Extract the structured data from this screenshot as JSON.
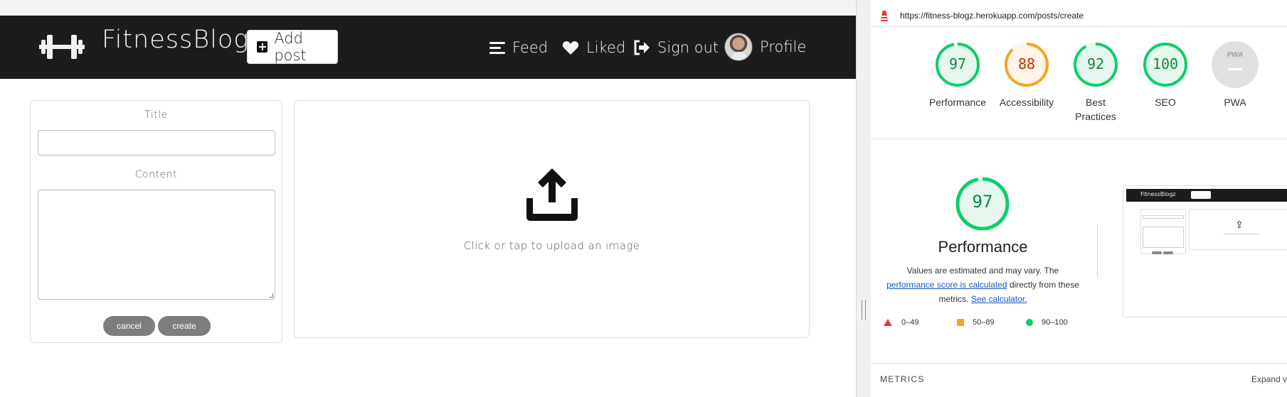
{
  "app": {
    "brand": "FitnessBlogz",
    "add_post_label": "Add post",
    "nav": {
      "feed": "Feed",
      "liked": "Liked",
      "sign_out": "Sign out",
      "profile": "Profile"
    },
    "form": {
      "title_label": "Title",
      "title_value": "",
      "content_label": "Content",
      "content_value": "",
      "cancel_label": "cancel",
      "create_label": "create"
    },
    "upload": {
      "text": "Click or tap to upload an image",
      "icon": "upload-icon"
    },
    "colors": {
      "navbar": "#1c1c1c",
      "pill": "#7d7d7d"
    }
  },
  "lighthouse": {
    "url": "https://fitness-blogz.herokuapp.com/posts/create",
    "categories": [
      {
        "name": "Performance",
        "score": 97,
        "color": "#0cce6b",
        "text_color": "#0a8a3f"
      },
      {
        "name": "Accessibility",
        "score": 88,
        "color": "#f4a623",
        "text_color": "#c33300"
      },
      {
        "name": "Best Practices",
        "score": 92,
        "color": "#0cce6b",
        "text_color": "#0a8a3f"
      },
      {
        "name": "SEO",
        "score": 100,
        "color": "#0cce6b",
        "text_color": "#0a8a3f"
      },
      {
        "name": "PWA",
        "score": null,
        "badge": "PWA"
      }
    ],
    "performance": {
      "score": 97,
      "title": "Performance",
      "desc_before": "Values are estimated and may vary. The",
      "desc_link": "performance score is calculated",
      "desc_after": "directly from these metrics.",
      "calculator_link": "See calculator."
    },
    "legend": [
      "0–49",
      "50–89",
      "90–100"
    ],
    "thumbnail": {
      "brand": "FitnessBlogz"
    },
    "metrics_heading": "METRICS",
    "expand_label": "Expand view"
  }
}
